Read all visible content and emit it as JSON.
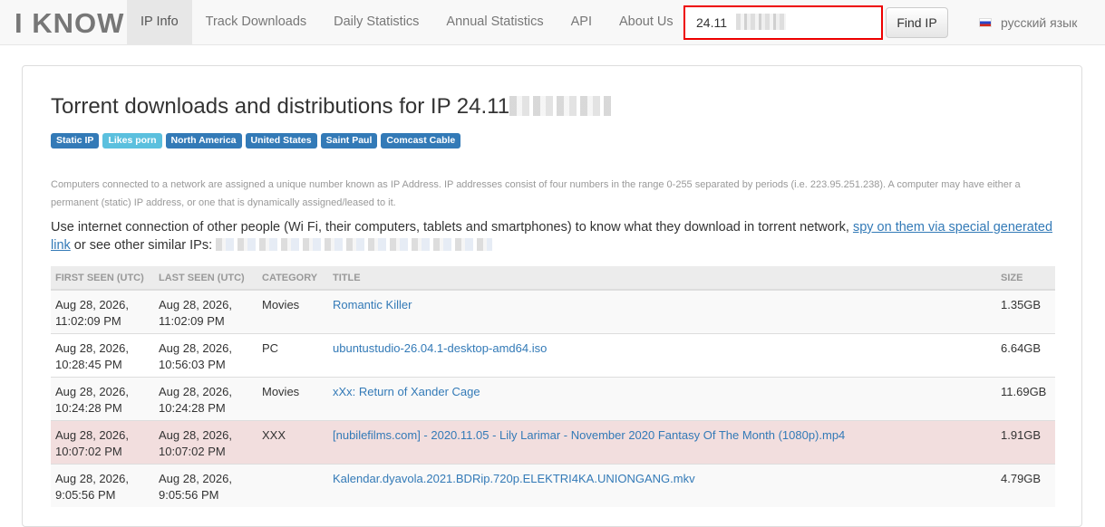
{
  "brand": "I KNOW",
  "nav": {
    "items": [
      "IP Info",
      "Track Downloads",
      "Daily Statistics",
      "Annual Statistics",
      "API",
      "About Us"
    ],
    "active": "IP Info"
  },
  "search": {
    "value": "24.11",
    "button": "Find IP"
  },
  "language": "русский язык",
  "page": {
    "title": "Torrent downloads and distributions for IP 24.11",
    "tags": [
      "Static IP",
      "Likes porn",
      "North America",
      "United States",
      "Saint Paul",
      "Comcast Cable"
    ],
    "description": "Computers connected to a network are assigned a unique number known as IP Address. IP addresses consist of four numbers in the range 0-255 separated by periods (i.e. 223.95.251.238). A computer may have either a permanent (static) IP address, or one that is dynamically assigned/leased to it.",
    "lead_text": "Use internet connection of other people (Wi Fi, their computers, tablets and smartphones) to know what they download in torrent network,",
    "lead_link": "spy on them via special generated link",
    "lead_suffix": "or see other similar IPs:"
  },
  "table": {
    "headers": {
      "first_seen": "FIRST SEEN (UTC)",
      "last_seen": "LAST SEEN (UTC)",
      "category": "CATEGORY",
      "title": "TITLE",
      "size": "SIZE"
    },
    "rows": [
      {
        "first_date": "Aug 28, 2026,",
        "first_time": "11:02:09 PM",
        "last_date": "Aug 28, 2026,",
        "last_time": "11:02:09 PM",
        "category": "Movies",
        "title": "Romantic Killer",
        "size": "1.35GB"
      },
      {
        "first_date": "Aug 28, 2026,",
        "first_time": "10:28:45 PM",
        "last_date": "Aug 28, 2026,",
        "last_time": "10:56:03 PM",
        "category": "PC",
        "title": "ubuntustudio-26.04.1-desktop-amd64.iso",
        "size": "6.64GB"
      },
      {
        "first_date": "Aug 28, 2026,",
        "first_time": "10:24:28 PM",
        "last_date": "Aug 28, 2026,",
        "last_time": "10:24:28 PM",
        "category": "Movies",
        "title": "xXx: Return of Xander Cage",
        "size": "11.69GB"
      },
      {
        "first_date": "Aug 28, 2026,",
        "first_time": "10:07:02 PM",
        "last_date": "Aug 28, 2026,",
        "last_time": "10:07:02 PM",
        "category": "XXX",
        "title": "[nubilefilms.com] - 2020.11.05 - Lily Larimar - November 2020 Fantasy Of The Month (1080p).mp4",
        "size": "1.91GB"
      },
      {
        "first_date": "Aug 28, 2026,",
        "first_time": "9:05:56 PM",
        "last_date": "Aug 28, 2026,",
        "last_time": "9:05:56 PM",
        "category": "",
        "title": "Kalendar.dyavola.2021.BDRip.720p.ELEKTRI4KA.UNIONGANG.mkv",
        "size": "4.79GB"
      }
    ]
  },
  "colors": {
    "accent": "#337ab7",
    "danger_row": "#f2dede",
    "highlight_border": "#ee0000"
  }
}
